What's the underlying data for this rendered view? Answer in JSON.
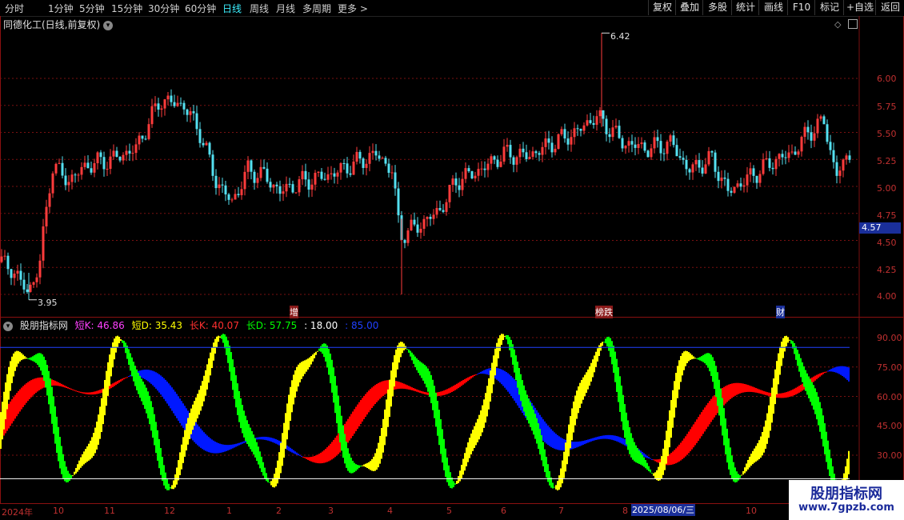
{
  "toolbar": {
    "periods": [
      "分时",
      "1分钟",
      "5分钟",
      "15分钟",
      "30分钟",
      "60分钟",
      "日线",
      "周线",
      "月线",
      "多周期",
      "更多 >"
    ],
    "active_period": "日线",
    "right_buttons": [
      "复权",
      "叠加",
      "多股",
      "统计",
      "画线",
      "F10",
      "标记",
      "+自选",
      "返回"
    ]
  },
  "stock": {
    "title": "同德化工(日线,前复权)",
    "price_axis": [
      "6.00",
      "5.75",
      "5.50",
      "5.25",
      "5.00",
      "4.75",
      "4.50",
      "4.25",
      "4.00"
    ],
    "current_price": "4.57",
    "high_label": "6.42",
    "low_label": "3.95",
    "events": [
      "增",
      "榜跌",
      "财"
    ]
  },
  "indicator": {
    "name": "股朋指标网",
    "values": [
      {
        "label": "短K: 46.86",
        "color": "#ff40ff"
      },
      {
        "label": "短D: 35.43",
        "color": "#ffff00"
      },
      {
        "label": "长K: 40.07",
        "color": "#ff3030"
      },
      {
        "label": "长D: 57.75",
        "color": "#00ff00"
      },
      {
        "label": ": 18.00",
        "color": "#ffffff"
      },
      {
        "label": ": 85.00",
        "color": "#2040ff"
      }
    ],
    "axis": [
      "90.00",
      "75.00",
      "60.00",
      "45.00",
      "30.00"
    ],
    "upper_line": 85,
    "lower_line": 18
  },
  "dates": {
    "labels": [
      "2024年",
      "10",
      "11",
      "12",
      "1",
      "2",
      "3",
      "4",
      "5",
      "6",
      "7",
      "8",
      "10"
    ],
    "cursor_date": "2025/08/06/三"
  },
  "watermark": {
    "line1": "股朋指标网",
    "line2": "www.7gpzb.com"
  },
  "colors": {
    "up": "#ff3b3b",
    "down": "#54e0f0",
    "grid": "#7a1010",
    "red_fill": "#ff0000",
    "blue_fill": "#0018ff",
    "yellow_fill": "#ffff00",
    "green_fill": "#00ff00"
  }
}
